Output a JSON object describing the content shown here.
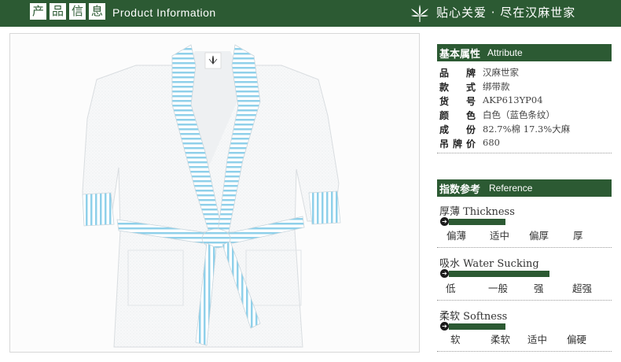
{
  "header": {
    "title_chars": [
      "产",
      "品",
      "信",
      "息"
    ],
    "title_en": "Product Information",
    "slogan": "贴心关爱 · 尽在汉麻世家",
    "leaf_icon": "hemp-leaf-icon"
  },
  "colors": {
    "brand_green": "#2c5a33",
    "stripe_blue": "#8fd0ea"
  },
  "attributes": {
    "title_cn": "基本属性",
    "title_en": "Attribute",
    "rows": [
      {
        "label": "品牌",
        "value": "汉麻世家"
      },
      {
        "label": "款式",
        "value": "绑带款"
      },
      {
        "label": "货号",
        "value": "AKP613YP04"
      },
      {
        "label": "颜色",
        "value": "白色（蓝色条纹）"
      },
      {
        "label": "成份",
        "value": "82.7%棉 17.3%大麻"
      },
      {
        "label": "吊牌价",
        "value": "680"
      }
    ]
  },
  "reference": {
    "title_cn": "指数参考",
    "title_en": "Reference",
    "indices": [
      {
        "title": "厚薄 Thickness",
        "level": 0.36,
        "scale": [
          "偏薄",
          "适中",
          "偏厚",
          "厚"
        ]
      },
      {
        "title": "吸水  Water Sucking",
        "level": 0.64,
        "scale": [
          "低",
          "一般",
          "强",
          "超强"
        ]
      },
      {
        "title": "柔软 Softness",
        "level": 0.36,
        "scale": [
          "软",
          "柔软",
          "适中",
          "偏硬"
        ]
      }
    ]
  },
  "product_image": {
    "subject": "white terry bathrobe with blue striped collar, cuffs and belt"
  }
}
